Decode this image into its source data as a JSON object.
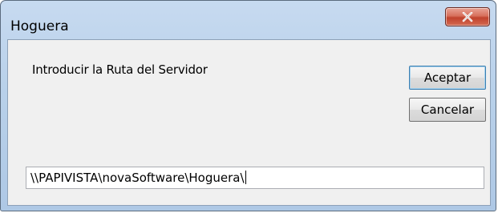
{
  "window": {
    "title": "Hoguera",
    "close_icon": "close-x-icon"
  },
  "dialog": {
    "prompt": "Introducir la Ruta del Servidor",
    "ok_label": "Aceptar",
    "cancel_label": "Cancelar",
    "path_value": "\\\\PAPIVISTA\\novaSoftware\\Hoguera\\"
  },
  "colors": {
    "close_button": "#c7503a",
    "frame": "#b9d1ea",
    "client_background": "#f0f0f0"
  }
}
